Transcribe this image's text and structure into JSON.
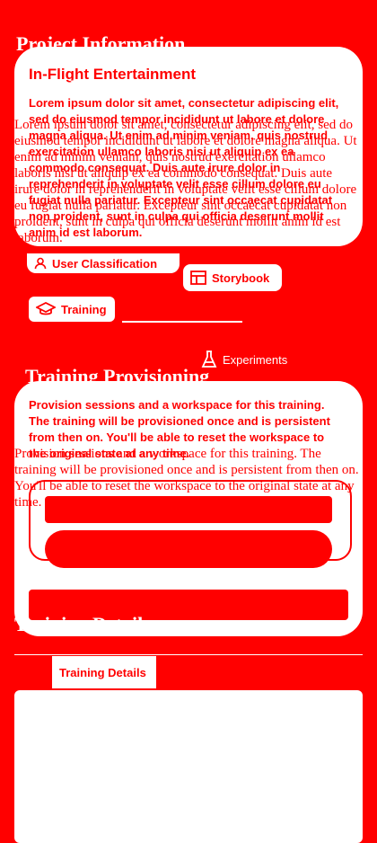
{
  "colors": {
    "background": "#ff0000",
    "surface": "#ffffff"
  },
  "project": {
    "heading": "Project Information",
    "card": {
      "title": "In-Flight Entertainment",
      "description": "Lorem ipsum dolor sit amet, consectetur adipiscing elit, sed do eiusmod tempor incididunt ut labore et dolore magna aliqua. Ut enim ad minim veniam, quis nostrud exercitation ullamco laboris nisi ut aliquip ex ea commodo consequat. Duis aute irure dolor in reprehenderit in voluptate velit esse cillum dolore eu fugiat nulla pariatur. Excepteur sint occaecat cupidatat non proident, sunt in culpa qui officia deserunt mollit anim id est laborum."
    },
    "overlay_title": "In-Flight Entertainment",
    "overlay_description": "Lorem ipsum dolor sit amet, consectetur adipiscing elit, sed do eiusmod tempor incididunt ut labore et dolore magna aliqua. Ut enim ad minim veniam, quis nostrud exercitation ullamco laboris nisi ut aliquip ex ea commodo consequat. Duis aute irure dolor in reprehenderit in voluptate velit esse cillum dolore eu fugiat nulla pariatur. Excepteur sint occaecat cupidatat non proident, sunt in culpa qui officia deserunt mollit anim id est laborum."
  },
  "links": {
    "user_classification": "User Classification",
    "storybook": "Storybook",
    "training": "Training",
    "experiments": "Experiments"
  },
  "provisioning": {
    "heading": "Training Provisioning",
    "card_text": "Provision sessions and a workspace for this training. The training will be provisioned once and is persistent from then on. You'll be able to reset the workspace to the original state at any time.",
    "overlay_text": "Provision sessions and a workspace for this training. The training will be provisioned once and is persistent from then on. You'll be able to reset the workspace to the original state at any time."
  },
  "details": {
    "heading": "Training Details",
    "tab": "Training Details"
  }
}
